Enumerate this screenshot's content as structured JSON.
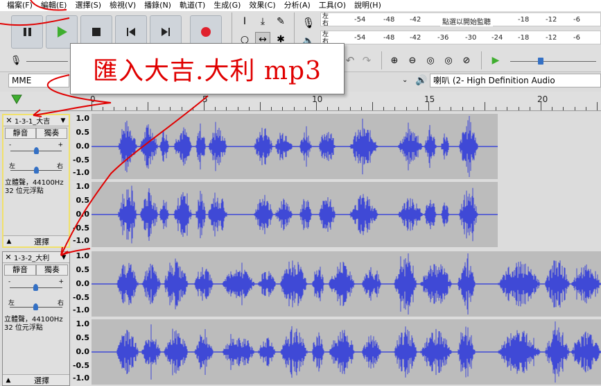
{
  "menu": [
    "檔案(F)",
    "編輯(E)",
    "選擇(S)",
    "檢視(V)",
    "播錄(N)",
    "軌道(T)",
    "生成(G)",
    "效果(C)",
    "分析(A)",
    "工具(O)",
    "說明(H)"
  ],
  "meter": {
    "left": "左",
    "right": "右",
    "ticks": [
      "-54",
      "-48",
      "-42",
      "-18",
      "-12",
      "-6"
    ],
    "ticks2": [
      "-54",
      "-48",
      "-42",
      "-36",
      "-30",
      "-24",
      "-18",
      "-12",
      "-6"
    ],
    "hint": "點選以開始監聽"
  },
  "host": "MME",
  "output_device": "喇叭 (2- High Definition Audio",
  "ruler": [
    "0",
    "5",
    "10",
    "15",
    "20"
  ],
  "tracks": [
    {
      "name": "1-3-1_大吉",
      "mute": "靜音",
      "solo": "獨奏",
      "pan_left": "左",
      "pan_right": "右",
      "minus": "-",
      "plus": "+",
      "format_line1": "立體聲，44100Hz",
      "format_line2": "32 位元浮點",
      "select": "選擇",
      "scale": [
        "1.0",
        "0.5",
        "0.0",
        "-0.5",
        "-1.0"
      ]
    },
    {
      "name": "1-3-2_大利",
      "mute": "靜音",
      "solo": "獨奏",
      "pan_left": "左",
      "pan_right": "右",
      "minus": "-",
      "plus": "+",
      "format_line1": "立體聲，44100Hz",
      "format_line2": "32 位元浮點",
      "select": "選擇",
      "scale": [
        "1.0",
        "0.5",
        "0.0",
        "-0.5",
        "-1.0"
      ]
    }
  ],
  "annotation": "匯入大吉.大利 mp3",
  "colors": {
    "wave": "#3f49d6",
    "accent": "#e00000",
    "play": "#3fae2f",
    "record": "#e0212d"
  }
}
